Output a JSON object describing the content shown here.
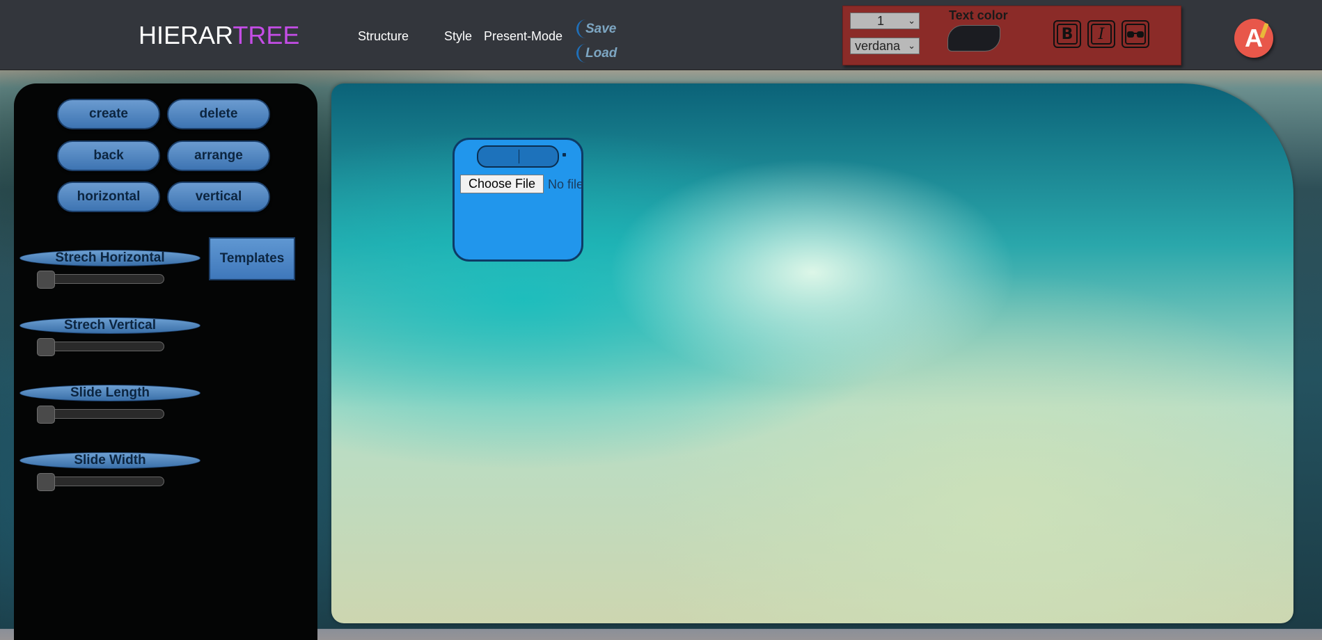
{
  "header": {
    "logo_part1": "HIERAR",
    "logo_part2": "TREE",
    "nav": [
      "Structure",
      "Style",
      "Present-Mode"
    ],
    "save_label": "Save",
    "load_label": "Load"
  },
  "toolbar": {
    "font_size_value": "1",
    "font_family_value": "verdana",
    "text_color_label": "Text color",
    "text_color_value": "#1b1c21",
    "bold_label": "B",
    "italic_label": "I",
    "glasses_icon": "glasses-icon"
  },
  "avatar": {
    "letter": "A"
  },
  "sidebar": {
    "buttons": [
      "create",
      "delete",
      "back",
      "arrange",
      "horizontal",
      "vertical"
    ],
    "templates_label": "Templates",
    "sliders": [
      {
        "label": "Strech Horizontal",
        "value": 0
      },
      {
        "label": "Strech Vertical",
        "value": 0
      },
      {
        "label": "Slide Length",
        "value": 0
      },
      {
        "label": "Slide Width",
        "value": 0
      }
    ]
  },
  "canvas": {
    "node": {
      "title_value": "",
      "file_button_label": "Choose File",
      "file_status": "No file chosen"
    }
  },
  "colors": {
    "topbar": "#33363c",
    "logo_accent": "#c44de6",
    "toolpanel": "#8b2b28",
    "node_fill": "#2196ec",
    "avatar": "#e8574a"
  }
}
